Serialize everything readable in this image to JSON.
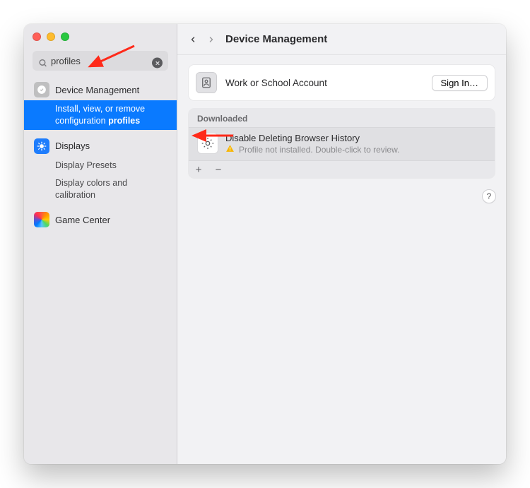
{
  "search": {
    "value": "profiles"
  },
  "sidebar": {
    "items": [
      {
        "label": "Device Management"
      },
      {
        "label": "Install, view, or remove configuration",
        "match": "profiles"
      },
      {
        "label": "Displays"
      },
      {
        "label": "Display Presets"
      },
      {
        "label": "Display colors and calibration"
      },
      {
        "label": "Game Center"
      }
    ]
  },
  "header": {
    "title": "Device Management"
  },
  "account": {
    "title": "Work or School Account",
    "signin": "Sign In…"
  },
  "downloaded": {
    "heading": "Downloaded",
    "profile_name": "Disable Deleting Browser History",
    "profile_status": "Profile not installed. Double-click to review."
  },
  "help": "?"
}
